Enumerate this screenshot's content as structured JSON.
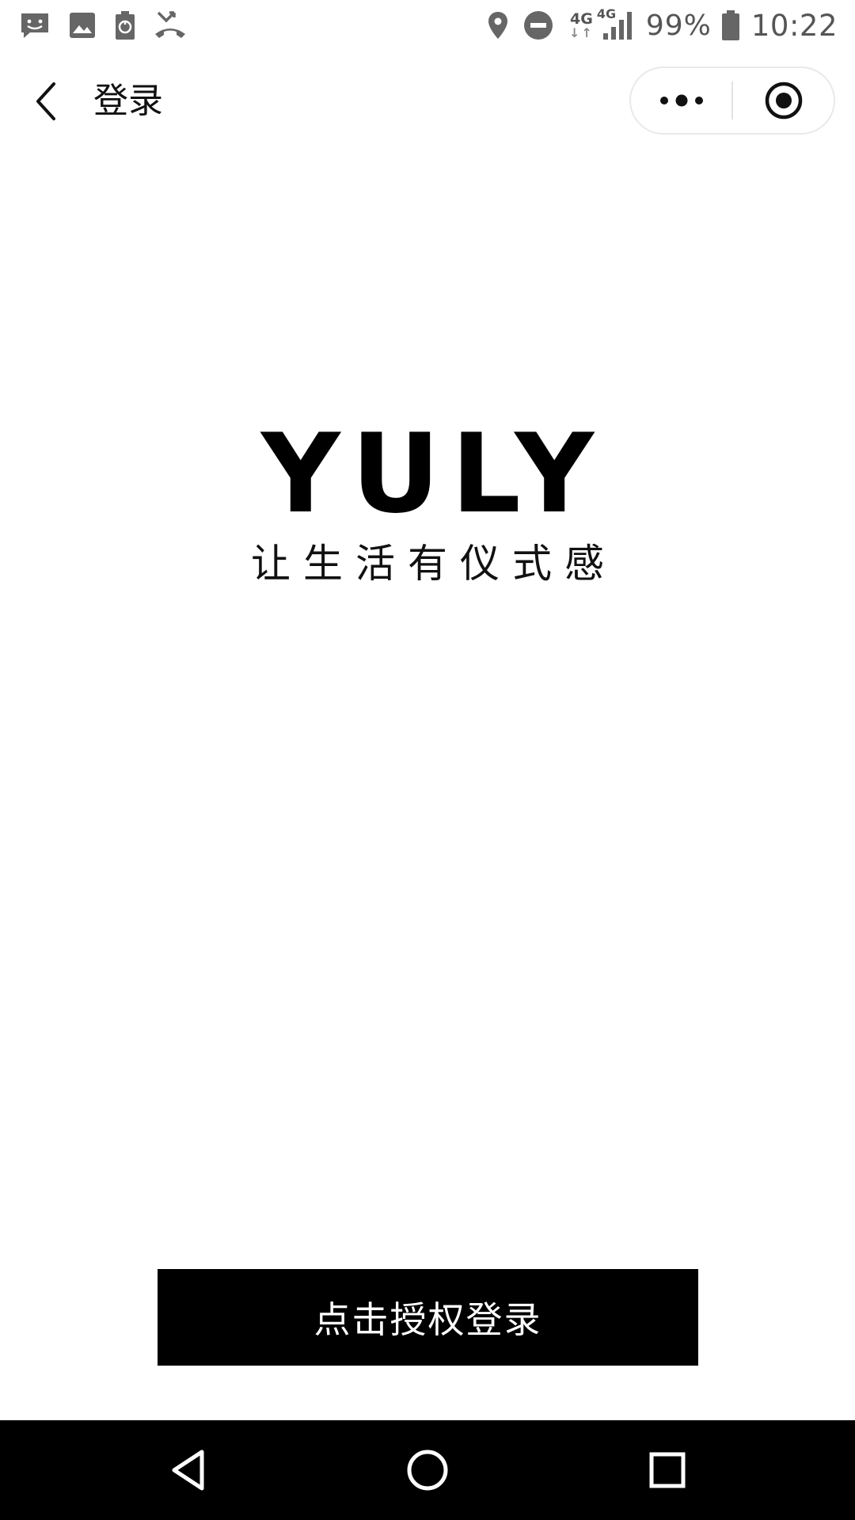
{
  "status_bar": {
    "left_icons": [
      "message-icon",
      "gallery-icon",
      "battery-saver-icon",
      "missed-call-icon"
    ],
    "network_type": "4G",
    "signal_network_type": "4G",
    "battery_percent": "99%",
    "time": "10:22"
  },
  "nav": {
    "title": "登录",
    "back_icon": "chevron-left-icon",
    "more_icon": "more-dots-icon",
    "close_icon": "target-close-icon"
  },
  "brand": {
    "logo": "YULY",
    "slogan": "让生活有仪式感"
  },
  "login": {
    "button_label": "点击授权登录"
  },
  "colors": {
    "button_bg": "#000000",
    "button_text": "#ffffff",
    "status_icons": "#555555",
    "system_nav_bg": "#000000"
  }
}
